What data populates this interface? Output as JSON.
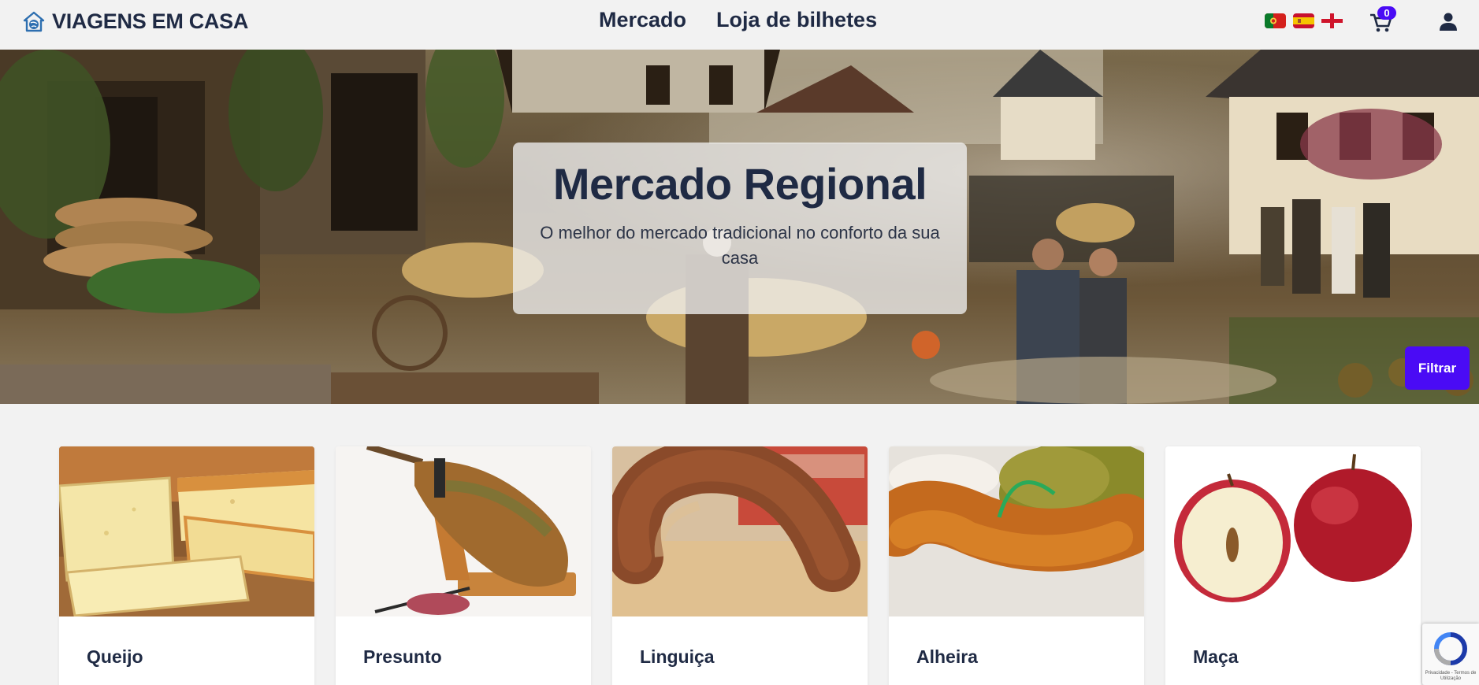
{
  "header": {
    "brand": "VIAGENS EM CASA",
    "nav": [
      {
        "label": "Mercado"
      },
      {
        "label": "Loja de bilhetes"
      }
    ],
    "languages": [
      "pt",
      "es",
      "en"
    ],
    "cart_count": "0"
  },
  "hero": {
    "title": "Mercado Regional",
    "subtitle": "O melhor do mercado tradicional no conforto da sua casa",
    "filter_label": "Filtrar"
  },
  "products": [
    {
      "name": "Queijo",
      "icon": "cheese-image"
    },
    {
      "name": "Presunto",
      "icon": "ham-image"
    },
    {
      "name": "Linguiça",
      "icon": "sausage-image"
    },
    {
      "name": "Alheira",
      "icon": "alheira-image"
    },
    {
      "name": "Maça",
      "icon": "apple-image"
    }
  ],
  "recaptcha": {
    "text": "Privacidade - Termos de Utilização"
  },
  "colors": {
    "accent": "#4a0bf5",
    "text": "#1f2a44",
    "background": "#f2f2f2"
  }
}
